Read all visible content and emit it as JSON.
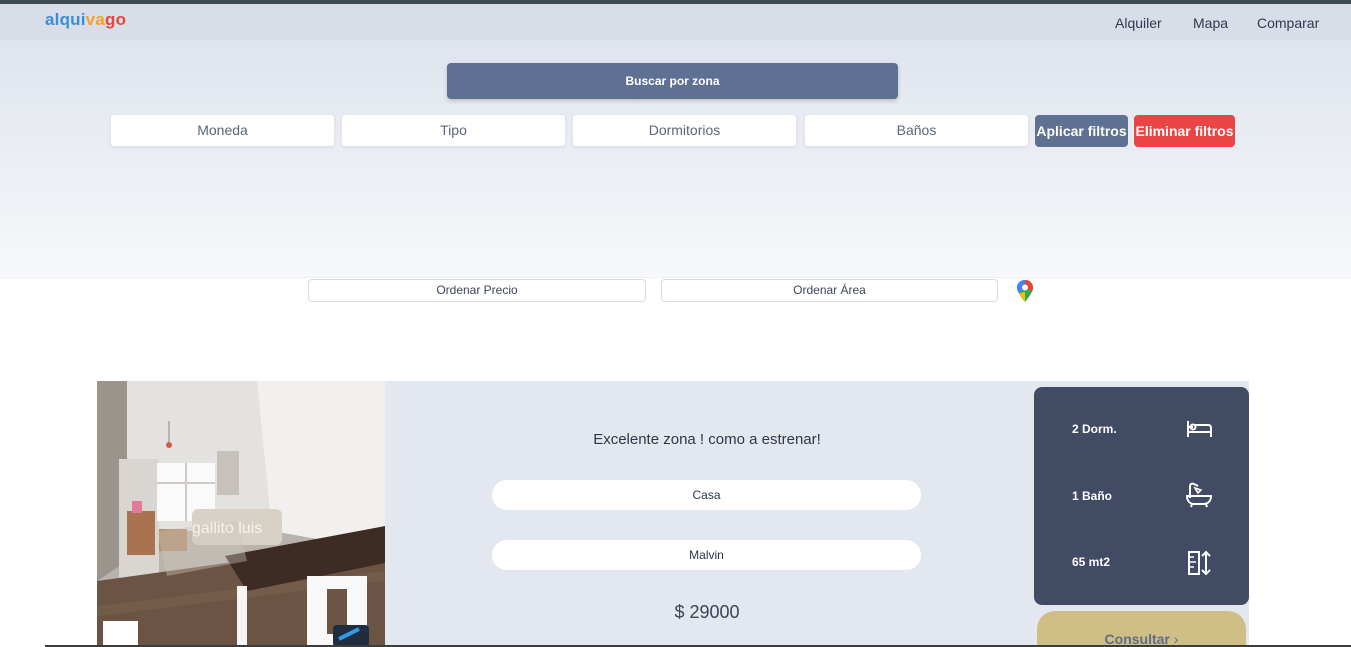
{
  "brand": {
    "part1": "alqui",
    "part2": "va",
    "part3": "go"
  },
  "nav": {
    "links": [
      "Alquiler",
      "Mapa",
      "Comparar"
    ]
  },
  "search": {
    "label": "Buscar por zona"
  },
  "filters": {
    "items": [
      "Moneda",
      "Tipo",
      "Dormitorios",
      "Baños"
    ],
    "apply_label": "Aplicar filtros",
    "clear_label": "Eliminar filtros"
  },
  "sort": {
    "price_label": "Ordenar Precio",
    "area_label": "Ordenar Área"
  },
  "listing": {
    "title": "Excelente zona ! como a estrenar!",
    "type": "Casa",
    "zone": "Malvin",
    "price": "$ 29000",
    "watermark": "gallito luis",
    "bedrooms": "2 Dorm.",
    "bathrooms": "1 Baño",
    "area": "65 mt2",
    "consult_label": "Consultar"
  },
  "colors": {
    "accent": "#5f7193",
    "danger": "#ea4545",
    "stats_panel": "#414b64",
    "consult": "#cfbf86"
  }
}
